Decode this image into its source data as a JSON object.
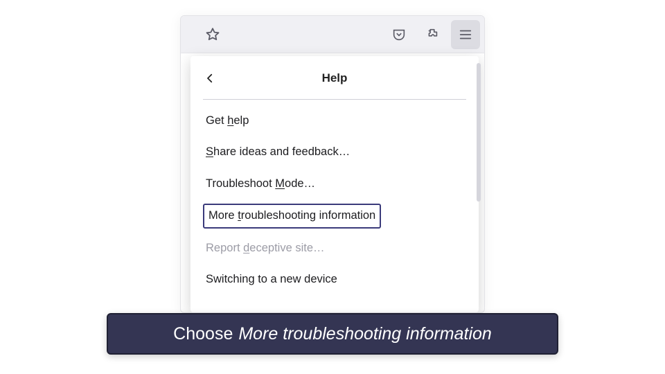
{
  "toolbar": {
    "star_name": "bookmark-star-icon",
    "pocket_name": "save-to-pocket-icon",
    "extensions_name": "extensions-icon",
    "menu_name": "application-menu-icon"
  },
  "menu": {
    "title": "Help",
    "items": [
      {
        "pre": "Get ",
        "mn": "h",
        "post": "elp",
        "enabled": true,
        "highlight": false
      },
      {
        "pre": "",
        "mn": "S",
        "post": "hare ideas and feedback…",
        "enabled": true,
        "highlight": false
      },
      {
        "pre": "Troubleshoot ",
        "mn": "M",
        "post": "ode…",
        "enabled": true,
        "highlight": false
      },
      {
        "pre": "More ",
        "mn": "t",
        "post": "roubleshooting information",
        "enabled": true,
        "highlight": true
      },
      {
        "pre": "Report ",
        "mn": "d",
        "post": "eceptive site…",
        "enabled": false,
        "highlight": false
      },
      {
        "pre": "Switching to a new device",
        "mn": "",
        "post": "",
        "enabled": true,
        "highlight": false
      }
    ]
  },
  "caption": {
    "lead": "Choose ",
    "emph": "More troubleshooting information"
  }
}
